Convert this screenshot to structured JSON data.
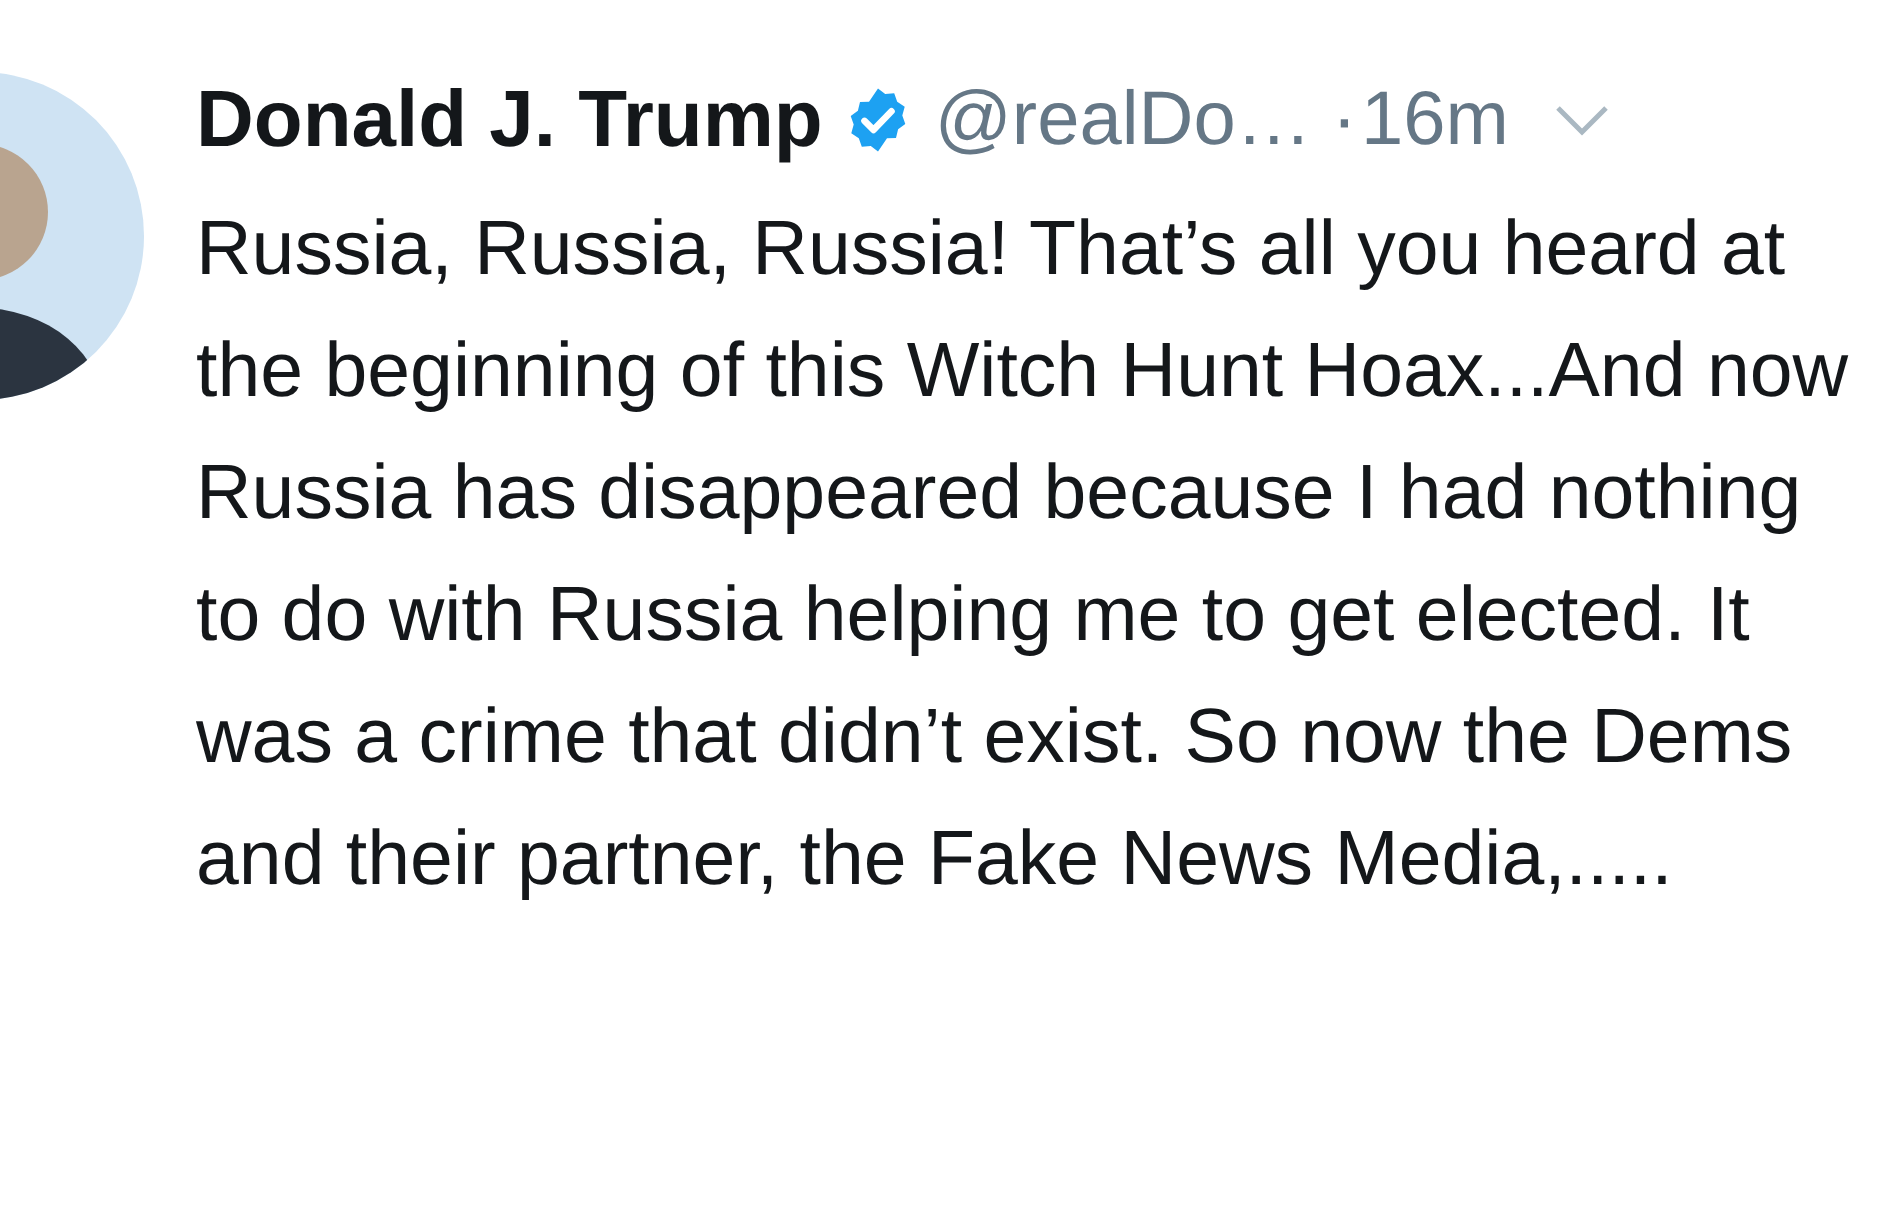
{
  "tweet": {
    "author": {
      "name": "Donald J. Trump",
      "verified": true,
      "handle": "@realDo…",
      "separator": "·",
      "time": "16m"
    },
    "text": "Russia, Russia, Russia! That’s all you heard at the beginning of this Witch Hunt Hoax...And now Russia has disappeared because I had nothing to do with Russia helping me to get elected. It was a crime that didn’t exist. So now the Dems and their partner, the Fake News Media,....."
  }
}
